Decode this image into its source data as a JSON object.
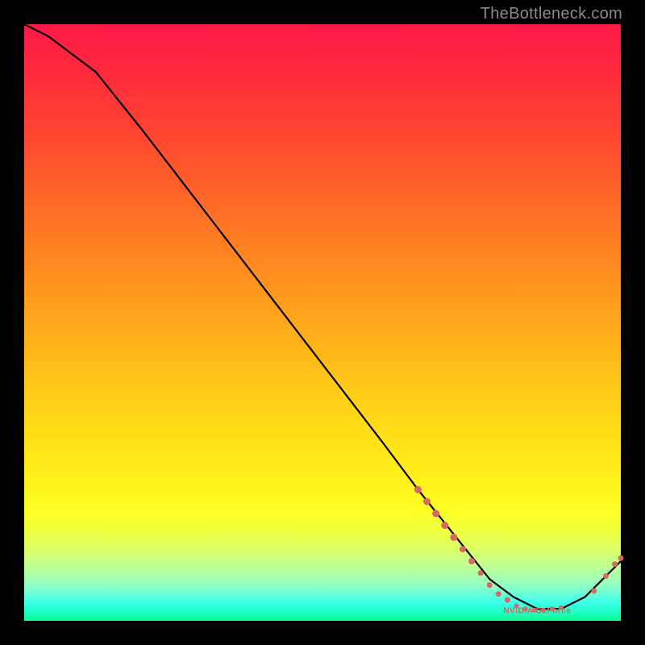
{
  "watermark": "TheBottleneck.com",
  "label_near_trough": "NVIDIA GeForce",
  "chart_data": {
    "type": "line",
    "title": "",
    "xlabel": "",
    "ylabel": "",
    "xlim": [
      0,
      100
    ],
    "ylim": [
      0,
      100
    ],
    "series": [
      {
        "name": "bottleneck-curve",
        "x": [
          0,
          4,
          8,
          12,
          20,
          30,
          40,
          50,
          60,
          66,
          70,
          74,
          78,
          82,
          86,
          90,
          94,
          97,
          100
        ],
        "y": [
          100,
          98,
          95,
          92,
          82,
          69,
          56,
          43,
          30,
          22,
          17,
          12,
          7,
          4,
          2,
          2,
          4,
          7,
          10
        ]
      }
    ],
    "markers": {
      "name": "cluster-dots",
      "points": [
        {
          "x": 66,
          "y": 22,
          "r": 4
        },
        {
          "x": 67.5,
          "y": 20,
          "r": 4
        },
        {
          "x": 69,
          "y": 18,
          "r": 4
        },
        {
          "x": 70.5,
          "y": 16,
          "r": 4
        },
        {
          "x": 72,
          "y": 14,
          "r": 4
        },
        {
          "x": 73.5,
          "y": 12,
          "r": 3.5
        },
        {
          "x": 75,
          "y": 10,
          "r": 3.5
        },
        {
          "x": 76.5,
          "y": 8,
          "r": 3
        },
        {
          "x": 78,
          "y": 6,
          "r": 3
        },
        {
          "x": 79.5,
          "y": 4.5,
          "r": 3
        },
        {
          "x": 81,
          "y": 3.5,
          "r": 3
        },
        {
          "x": 82.5,
          "y": 2.5,
          "r": 2.5
        },
        {
          "x": 84,
          "y": 2,
          "r": 2.5
        },
        {
          "x": 85.5,
          "y": 1.8,
          "r": 2.5
        },
        {
          "x": 87,
          "y": 1.8,
          "r": 2.5
        },
        {
          "x": 88.5,
          "y": 2,
          "r": 2.5
        },
        {
          "x": 90,
          "y": 2.2,
          "r": 2.5
        },
        {
          "x": 95.5,
          "y": 5,
          "r": 3
        },
        {
          "x": 97.5,
          "y": 7.5,
          "r": 3
        },
        {
          "x": 99,
          "y": 9.5,
          "r": 3
        },
        {
          "x": 100,
          "y": 10.5,
          "r": 3
        }
      ]
    }
  }
}
